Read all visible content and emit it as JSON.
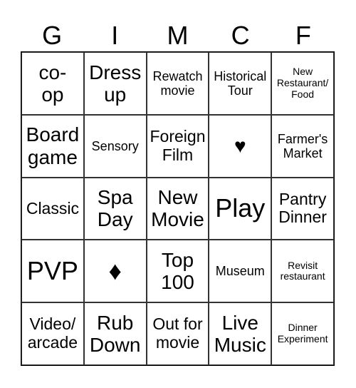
{
  "header": [
    "G",
    "I",
    "M",
    "C",
    "F"
  ],
  "cells": [
    {
      "text": "co-\nop",
      "size": "l"
    },
    {
      "text": "Dress up",
      "size": "l"
    },
    {
      "text": "Rewatch movie",
      "size": "s"
    },
    {
      "text": "Historical Tour",
      "size": "s"
    },
    {
      "text": "New Restaurant/ Food",
      "size": "xs"
    },
    {
      "text": "Board game",
      "size": "l"
    },
    {
      "text": "Sensory",
      "size": "s"
    },
    {
      "text": "Foreign Film",
      "size": "m"
    },
    {
      "text": "♥",
      "size": "l"
    },
    {
      "text": "Farmer's Market",
      "size": "s"
    },
    {
      "text": "Classic",
      "size": "m"
    },
    {
      "text": "Spa Day",
      "size": "l"
    },
    {
      "text": "New Movie",
      "size": "l"
    },
    {
      "text": "Play",
      "size": "xl"
    },
    {
      "text": "Pantry Dinner",
      "size": "m"
    },
    {
      "text": "PVP",
      "size": "xl"
    },
    {
      "text": "♦",
      "size": "xl"
    },
    {
      "text": "Top 100",
      "size": "l"
    },
    {
      "text": "Museum",
      "size": "s"
    },
    {
      "text": "Revisit restaurant",
      "size": "xs"
    },
    {
      "text": "Video/ arcade",
      "size": "m"
    },
    {
      "text": "Rub Down",
      "size": "l"
    },
    {
      "text": "Out for movie",
      "size": "m"
    },
    {
      "text": "Live Music",
      "size": "l"
    },
    {
      "text": "Dinner Experiment",
      "size": "xs"
    }
  ]
}
